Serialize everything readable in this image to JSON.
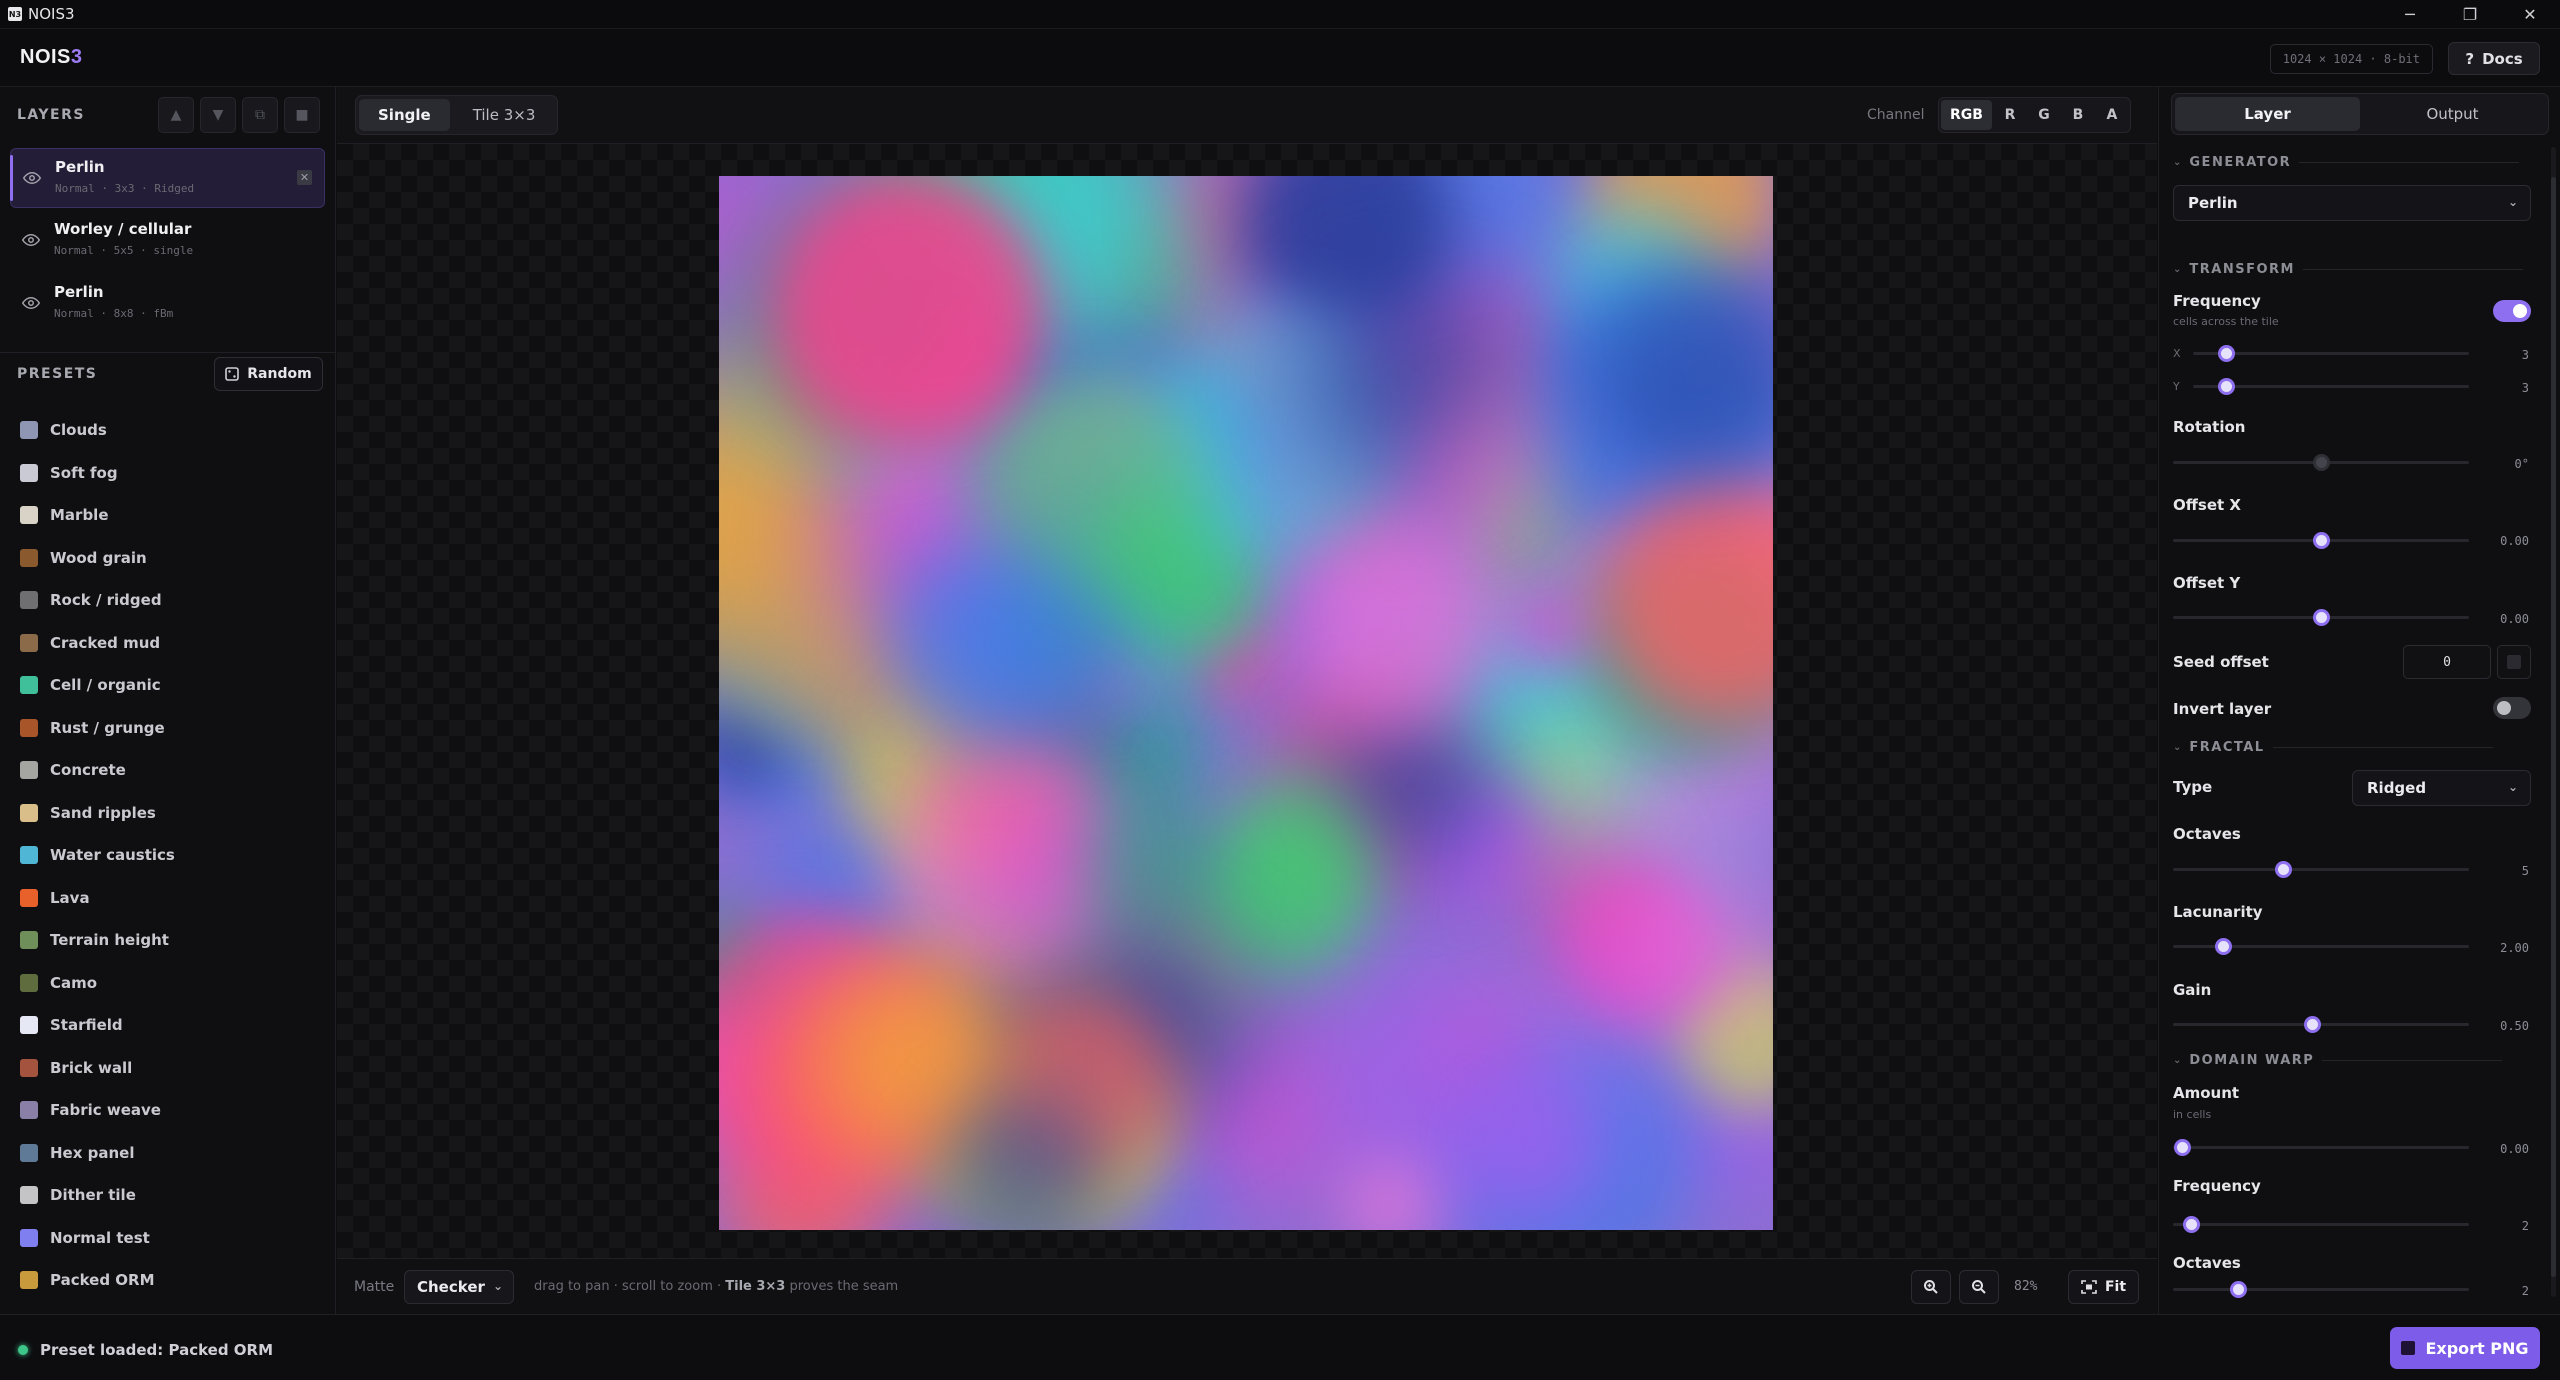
{
  "window": {
    "icon": "N3",
    "title": "NOIS3",
    "minimize": "─",
    "maximize": "❐",
    "close": "✕"
  },
  "header": {
    "brand_main": "NOIS",
    "brand_accent": "3",
    "resolution": "1024 × 1024 · 8-bit",
    "docs_label": "Docs",
    "docs_icon": "?"
  },
  "layers": {
    "title": "LAYERS",
    "tools": [
      "▲",
      "▼",
      "⧉",
      "■"
    ],
    "items": [
      {
        "name": "Perlin",
        "meta": "Normal · 3x3 · Ridged",
        "active": true
      },
      {
        "name": "Worley / cellular",
        "meta": "Normal · 5x5 · single",
        "active": false
      },
      {
        "name": "Perlin",
        "meta": "Normal · 8x8 · fBm",
        "active": false
      }
    ]
  },
  "presets": {
    "title": "PRESETS",
    "random_label": "Random",
    "items": [
      {
        "name": "Clouds",
        "color": "#8e96b4"
      },
      {
        "name": "Soft fog",
        "color": "#c9cad3"
      },
      {
        "name": "Marble",
        "color": "#d8d3c6"
      },
      {
        "name": "Wood grain",
        "color": "#8a5a2e"
      },
      {
        "name": "Rock / ridged",
        "color": "#6f6f72"
      },
      {
        "name": "Cracked mud",
        "color": "#8a6a48"
      },
      {
        "name": "Cell / organic",
        "color": "#3fbf9a"
      },
      {
        "name": "Rust / grunge",
        "color": "#a8552a"
      },
      {
        "name": "Concrete",
        "color": "#a5a5a2"
      },
      {
        "name": "Sand ripples",
        "color": "#d9be8a"
      },
      {
        "name": "Water caustics",
        "color": "#4fb6d6"
      },
      {
        "name": "Lava",
        "color": "#e8602a"
      },
      {
        "name": "Terrain height",
        "color": "#6f8f5a"
      },
      {
        "name": "Camo",
        "color": "#5f6d3e"
      },
      {
        "name": "Starfield",
        "color": "#e6e8f5"
      },
      {
        "name": "Brick wall",
        "color": "#a4533e"
      },
      {
        "name": "Fabric weave",
        "color": "#8a7fa6"
      },
      {
        "name": "Hex panel",
        "color": "#5f7a96"
      },
      {
        "name": "Dither tile",
        "color": "#c4c4c6"
      },
      {
        "name": "Normal test",
        "color": "#7f7ff0"
      },
      {
        "name": "Packed ORM",
        "color": "#c99a3c"
      }
    ]
  },
  "viewport": {
    "tabs": [
      {
        "label": "Single",
        "active": true
      },
      {
        "label": "Tile 3×3",
        "active": false
      }
    ],
    "channel_label": "Channel",
    "channels": [
      {
        "label": "RGB",
        "active": true
      },
      {
        "label": "R"
      },
      {
        "label": "G"
      },
      {
        "label": "B"
      },
      {
        "label": "A"
      }
    ],
    "matte_label": "Matte",
    "matte_value": "Checker",
    "hint_a": "drag to pan · scroll to zoom · ",
    "hint_b": "Tile 3×3",
    "hint_c": " proves the seam",
    "zoom_level": "82%",
    "fit_label": "Fit"
  },
  "rpanel": {
    "tabs": [
      {
        "label": "Layer",
        "active": true
      },
      {
        "label": "Output",
        "active": false
      }
    ],
    "generator": {
      "title": "GENERATOR",
      "value": "Perlin"
    },
    "transform": {
      "title": "TRANSFORM",
      "frequency": {
        "label": "Frequency",
        "sub": "cells across the tile",
        "enabled": true,
        "x": {
          "axis": "X",
          "value": 3,
          "display": "3",
          "fraction": 0.12
        },
        "y": {
          "axis": "Y",
          "value": 3,
          "display": "3",
          "fraction": 0.12
        }
      },
      "rotation": {
        "label": "Rotation",
        "display": "0°",
        "fraction": 0.5
      },
      "offset_x": {
        "label": "Offset X",
        "display": "0.00",
        "fraction": 0.5
      },
      "offset_y": {
        "label": "Offset Y",
        "display": "0.00",
        "fraction": 0.5
      },
      "seed": {
        "label": "Seed offset",
        "value": "0"
      },
      "invert": {
        "label": "Invert layer",
        "enabled": false
      }
    },
    "fractal": {
      "title": "FRACTAL",
      "type_label": "Type",
      "type_value": "Ridged",
      "octaves": {
        "label": "Octaves",
        "display": "5",
        "fraction": 0.37
      },
      "lacunarity": {
        "label": "Lacunarity",
        "display": "2.00",
        "fraction": 0.17
      },
      "gain": {
        "label": "Gain",
        "display": "0.50",
        "fraction": 0.47
      }
    },
    "domain_warp": {
      "title": "DOMAIN WARP",
      "amount": {
        "label": "Amount",
        "sub": "in cells",
        "display": "0.00",
        "fraction": 0.03
      },
      "frequency": {
        "label": "Frequency",
        "display": "2",
        "fraction": 0.06
      },
      "octaves": {
        "label": "Octaves",
        "display": "2",
        "fraction": 0.22
      }
    }
  },
  "status": {
    "text": "Preset loaded: Packed ORM",
    "color": "#3ec58a",
    "export_label": "Export PNG"
  },
  "colors": {
    "accent": "#8d6ff0",
    "export": "#7c5ce8"
  }
}
